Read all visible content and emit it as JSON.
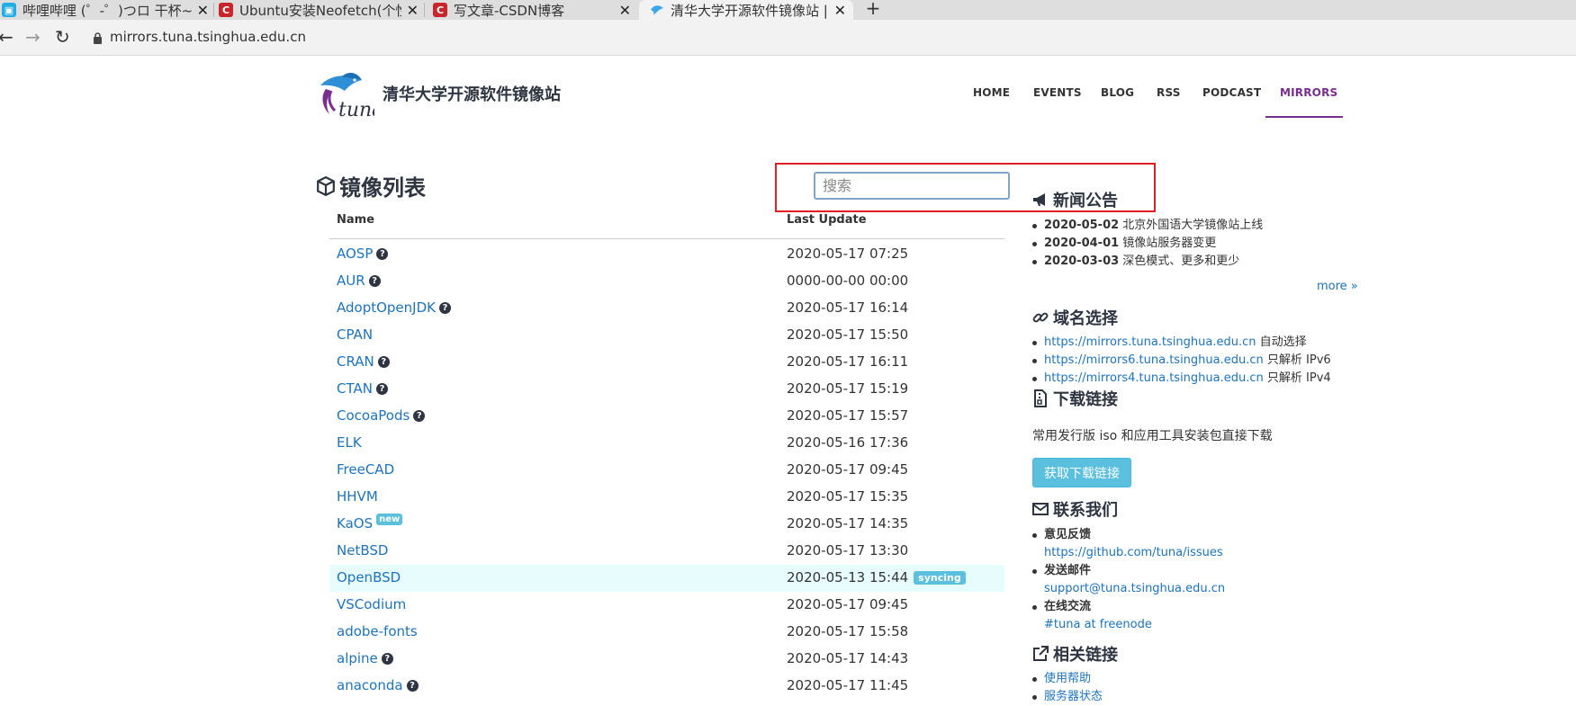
{
  "browser": {
    "tabs": [
      {
        "title": "哔哩哔哩 (゜-゜)つロ 干杯~-bilibili"
      },
      {
        "title": "Ubuntu安装Neofetch(个性化终端)"
      },
      {
        "title": "写文章-CSDN博客"
      },
      {
        "title": "清华大学开源软件镜像站 | Tsinghua"
      }
    ],
    "new_tab_label": "+",
    "url": "mirrors.tuna.tsinghua.edu.cn"
  },
  "site": {
    "logo_text": "tuna",
    "title": "清华大学开源软件镜像站",
    "nav": [
      "HOME",
      "EVENTS",
      "BLOG",
      "RSS",
      "PODCAST",
      "MIRRORS"
    ]
  },
  "mirrors": {
    "heading": "镜像列表",
    "search_placeholder": "搜索",
    "col_name": "Name",
    "col_update": "Last Update",
    "rows": [
      {
        "name": "AOSP",
        "help": true,
        "date": "2020-05-17 07:25"
      },
      {
        "name": "AUR",
        "help": true,
        "date": "0000-00-00 00:00"
      },
      {
        "name": "AdoptOpenJDK",
        "help": true,
        "date": "2020-05-17 16:14"
      },
      {
        "name": "CPAN",
        "help": false,
        "date": "2020-05-17 15:50"
      },
      {
        "name": "CRAN",
        "help": true,
        "date": "2020-05-17 16:11"
      },
      {
        "name": "CTAN",
        "help": true,
        "date": "2020-05-17 15:19"
      },
      {
        "name": "CocoaPods",
        "help": true,
        "date": "2020-05-17 15:57"
      },
      {
        "name": "ELK",
        "help": false,
        "date": "2020-05-16 17:36"
      },
      {
        "name": "FreeCAD",
        "help": false,
        "date": "2020-05-17 09:45"
      },
      {
        "name": "HHVM",
        "help": false,
        "date": "2020-05-17 15:35"
      },
      {
        "name": "KaOS",
        "help": false,
        "badge": "new",
        "date": "2020-05-17 14:35"
      },
      {
        "name": "NetBSD",
        "help": false,
        "date": "2020-05-17 13:30"
      },
      {
        "name": "OpenBSD",
        "help": false,
        "date": "2020-05-13 15:44",
        "status": "syncing",
        "highlight": true
      },
      {
        "name": "VSCodium",
        "help": false,
        "date": "2020-05-17 09:45"
      },
      {
        "name": "adobe-fonts",
        "help": false,
        "date": "2020-05-17 15:58"
      },
      {
        "name": "alpine",
        "help": true,
        "date": "2020-05-17 14:43"
      },
      {
        "name": "anaconda",
        "help": true,
        "date": "2020-05-17 11:45"
      }
    ]
  },
  "news": {
    "heading": "新闻公告",
    "items": [
      {
        "date": "2020-05-02",
        "text": "北京外国语大学镜像站上线"
      },
      {
        "date": "2020-04-01",
        "text": "镜像站服务器变更"
      },
      {
        "date": "2020-03-03",
        "text": "深色模式、更多和更少"
      }
    ],
    "more": "more »"
  },
  "domains": {
    "heading": "域名选择",
    "items": [
      {
        "url": "https://mirrors.tuna.tsinghua.edu.cn",
        "note": "自动选择"
      },
      {
        "url": "https://mirrors6.tuna.tsinghua.edu.cn",
        "note": "只解析 IPv6"
      },
      {
        "url": "https://mirrors4.tuna.tsinghua.edu.cn",
        "note": "只解析 IPv4"
      }
    ]
  },
  "download": {
    "heading": "下载链接",
    "text": "常用发行版 iso 和应用工具安装包直接下载",
    "button": "获取下载链接"
  },
  "contact": {
    "heading": "联系我们",
    "items": [
      {
        "label": "意见反馈",
        "value": "https://github.com/tuna/issues"
      },
      {
        "label": "发送邮件",
        "value": "support@tuna.tsinghua.edu.cn"
      },
      {
        "label": "在线交流",
        "value": "#tuna at freenode"
      }
    ]
  },
  "links": {
    "heading": "相关链接",
    "items": [
      "使用帮助",
      "服务器状态"
    ]
  }
}
